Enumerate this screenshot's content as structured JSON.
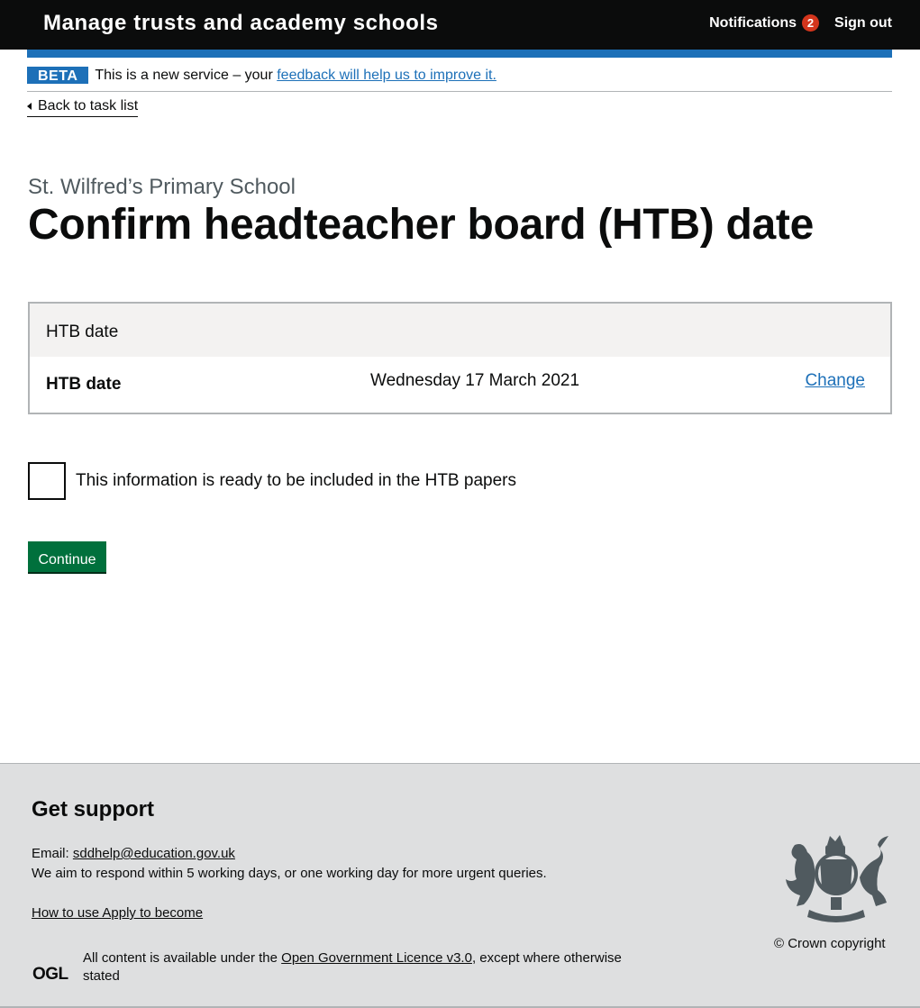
{
  "header": {
    "title": "Manage trusts and academy schools",
    "notifications_label": "Notifications",
    "notifications_count": "2",
    "sign_out_label": "Sign out"
  },
  "phase_banner": {
    "tag": "BETA",
    "text": "This is a new service – your",
    "link": "feedback will help us to improve it."
  },
  "back_link": "Back to task list",
  "caption": "St. Wilfred’s Primary School",
  "title": "Confirm headteacher board (HTB) date",
  "summary": {
    "heading": "HTB date",
    "rows": [
      {
        "key": "HTB date",
        "value": "Wednesday 17 March 2021",
        "action": "Change"
      }
    ]
  },
  "checkbox": {
    "label": "This information is ready to be included in the HTB papers",
    "checked": false
  },
  "continue_label": "Continue",
  "footer": {
    "heading": "Get support",
    "email_label": "Email:",
    "email": "sddhelp@education.gov.uk",
    "respond_text": "We aim to respond within 5 working days, or one working day for more urgent queries.",
    "how_to_link": "How to use Apply to become",
    "ogl_logo": "OGL",
    "licence_prefix": "All content is available under the",
    "licence_link": "Open Government Licence v3.0",
    "licence_suffix": ", except where otherwise stated",
    "copyright": "© Crown copyright"
  },
  "colors": {
    "header_bg": "#0b0c0c",
    "brand_blue": "#1d70b8",
    "button_green": "#00703c",
    "badge_red": "#d4351c",
    "footer_bg": "#dedfe0"
  }
}
